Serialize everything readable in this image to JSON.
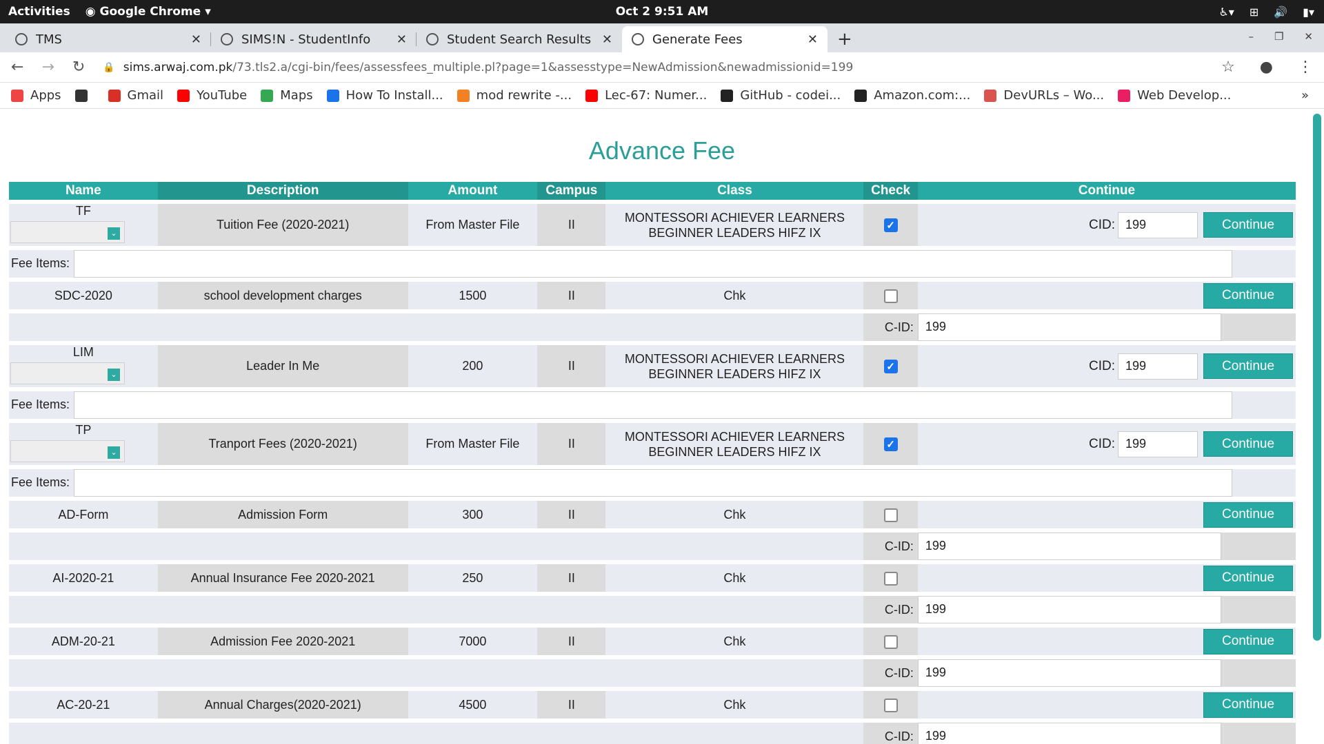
{
  "os": {
    "activities": "Activities",
    "app_name": "Google Chrome",
    "clock": "Oct 2  9:51 AM"
  },
  "tabs": [
    {
      "label": "TMS"
    },
    {
      "label": "SIMS!N - StudentInfo"
    },
    {
      "label": "Student Search Results"
    },
    {
      "label": "Generate Fees"
    }
  ],
  "url": {
    "host": "sims.arwaj.com.pk",
    "path": "/73.tls2.a/cgi-bin/fees/assessfees_multiple.pl?page=1&assesstype=NewAdmission&newadmissionid=199"
  },
  "bookmarks": [
    {
      "label": "Apps",
      "icon": "apps-grid-icon",
      "color": "#e44"
    },
    {
      "label": "",
      "icon": "globe-icon",
      "color": "#333"
    },
    {
      "label": "Gmail",
      "icon": "gmail-icon",
      "color": "#d93025"
    },
    {
      "label": "YouTube",
      "icon": "youtube-icon",
      "color": "#f00"
    },
    {
      "label": "Maps",
      "icon": "maps-icon",
      "color": "#34a853"
    },
    {
      "label": "How To Install...",
      "icon": "refresh-blue-icon",
      "color": "#1a73e8"
    },
    {
      "label": "mod rewrite -...",
      "icon": "stackoverflow-icon",
      "color": "#f48024"
    },
    {
      "label": "Lec-67: Numer...",
      "icon": "youtube-icon",
      "color": "#f00"
    },
    {
      "label": "GitHub - codei...",
      "icon": "github-icon",
      "color": "#222"
    },
    {
      "label": "Amazon.com:...",
      "icon": "amazon-icon",
      "color": "#222"
    },
    {
      "label": "DevURLs – Wo...",
      "icon": "devurls-icon",
      "color": "#d9534f"
    },
    {
      "label": "Web Develop...",
      "icon": "webdev-icon",
      "color": "#e91e63"
    }
  ],
  "page": {
    "title": "Advance Fee",
    "headers": [
      "Name",
      "Description",
      "Amount",
      "Campus",
      "Class",
      "Check",
      "Continue"
    ],
    "fee_items_label": "Fee Items:",
    "cid_label": "CID:",
    "cid2_label": "C-ID:",
    "continue_label": "Continue",
    "rows": [
      {
        "name": "TF",
        "desc": "Tuition Fee (2020-2021)",
        "amount": "From Master File",
        "campus": "II",
        "cls": "MONTESSORI ACHIEVER LEARNERS BEGINNER LEADERS HIFZ IX",
        "checked": true,
        "cid": "199",
        "type": "select"
      },
      {
        "name": "SDC-2020",
        "desc": "school development charges",
        "amount": "1500",
        "campus": "II",
        "cls": "Chk",
        "checked": false,
        "cid": "199",
        "type": "plain"
      },
      {
        "name": "LIM",
        "desc": "Leader In Me",
        "amount": "200",
        "campus": "II",
        "cls": "MONTESSORI ACHIEVER LEARNERS BEGINNER LEADERS HIFZ IX",
        "checked": true,
        "cid": "199",
        "type": "select"
      },
      {
        "name": "TP",
        "desc": "Tranport Fees (2020-2021)",
        "amount": "From Master File",
        "campus": "II",
        "cls": "MONTESSORI ACHIEVER LEARNERS BEGINNER LEADERS HIFZ IX",
        "checked": true,
        "cid": "199",
        "type": "select"
      },
      {
        "name": "AD-Form",
        "desc": "Admission Form",
        "amount": "300",
        "campus": "II",
        "cls": "Chk",
        "checked": false,
        "cid": "199",
        "type": "plain"
      },
      {
        "name": "AI-2020-21",
        "desc": "Annual Insurance Fee 2020-2021",
        "amount": "250",
        "campus": "II",
        "cls": "Chk",
        "checked": false,
        "cid": "199",
        "type": "plain"
      },
      {
        "name": "ADM-20-21",
        "desc": "Admission Fee 2020-2021",
        "amount": "7000",
        "campus": "II",
        "cls": "Chk",
        "checked": false,
        "cid": "199",
        "type": "plain"
      },
      {
        "name": "AC-20-21",
        "desc": "Annual Charges(2020-2021)",
        "amount": "4500",
        "campus": "II",
        "cls": "Chk",
        "checked": false,
        "cid": "199",
        "type": "plain"
      }
    ]
  }
}
